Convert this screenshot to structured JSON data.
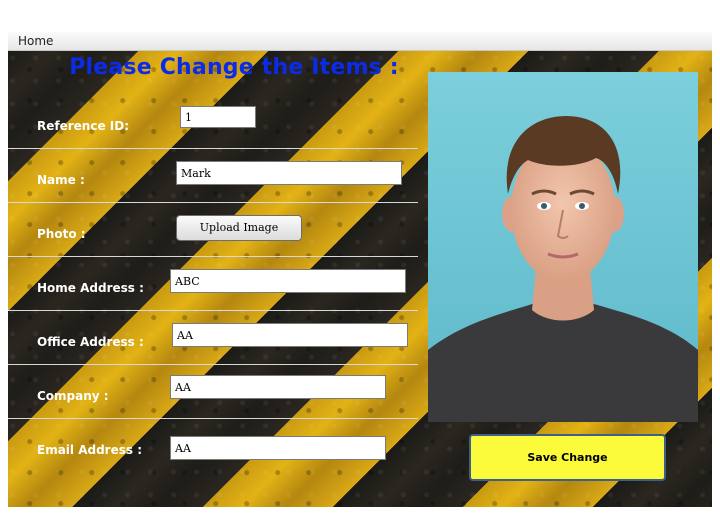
{
  "menu": {
    "home": "Home"
  },
  "form": {
    "heading": "Please Change the Items :",
    "reference_id": {
      "label": "Reference ID:",
      "value": "1"
    },
    "name": {
      "label": "Name :",
      "value": "Mark"
    },
    "photo": {
      "label": "Photo :",
      "button": "Upload Image"
    },
    "home_address": {
      "label": "Home Address :",
      "value": "ABC"
    },
    "office_address": {
      "label": "Office Address :",
      "value": "AA"
    },
    "company": {
      "label": "Company :",
      "value": "AA"
    },
    "email_address": {
      "label": "Email Address :",
      "value": "AA"
    }
  },
  "save_button": "Save Change",
  "colors": {
    "heading": "#0b2be8",
    "save_button_bg": "#fbfb3c",
    "stripe_yellow": "#e2b215",
    "stripe_dark": "#1f1d19",
    "photo_bg": "#6fc6d6"
  }
}
